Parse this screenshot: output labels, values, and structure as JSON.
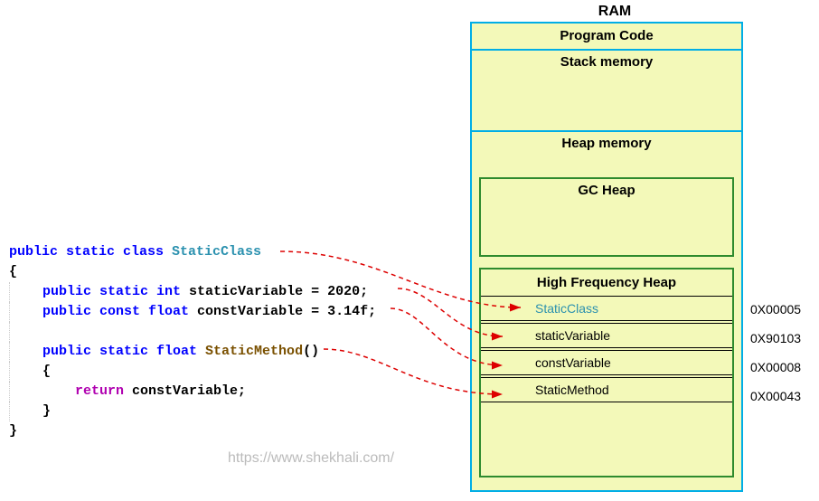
{
  "code": {
    "line1_public": "public",
    "line1_static": " static",
    "line1_class": " class ",
    "line1_name": "StaticClass",
    "brace_open": "{",
    "line2_public": "    public",
    "line2_static": " static",
    "line2_int": " int",
    "line2_rest": " staticVariable = 2020;",
    "line3_public": "    public",
    "line3_const": " const",
    "line3_float": " float",
    "line3_rest": " constVariable = 3.14f;",
    "line4_spacer": " ",
    "line5_public": "    public",
    "line5_static": " static",
    "line5_float": " float ",
    "line5_name": "StaticMethod",
    "line5_paren": "()",
    "line5_brace": "    {",
    "line6_indent": "        ",
    "line6_return": "return",
    "line6_rest": " constVariable;",
    "line6_brace_close": "    }",
    "brace_close": "}"
  },
  "ram": {
    "title": "RAM",
    "program_code": "Program Code",
    "stack": "Stack memory",
    "heap": "Heap memory",
    "gc_heap": "GC Heap",
    "hf_heap": "High Frequency Heap",
    "rows": {
      "r0": "StaticClass",
      "r1": "staticVariable",
      "r2": "constVariable",
      "r3": "StaticMethod"
    },
    "addr": {
      "a0": "0X00005",
      "a1": "0X90103",
      "a2": "0X00008",
      "a3": "0X00043"
    }
  },
  "watermark": "https://www.shekhali.com/"
}
